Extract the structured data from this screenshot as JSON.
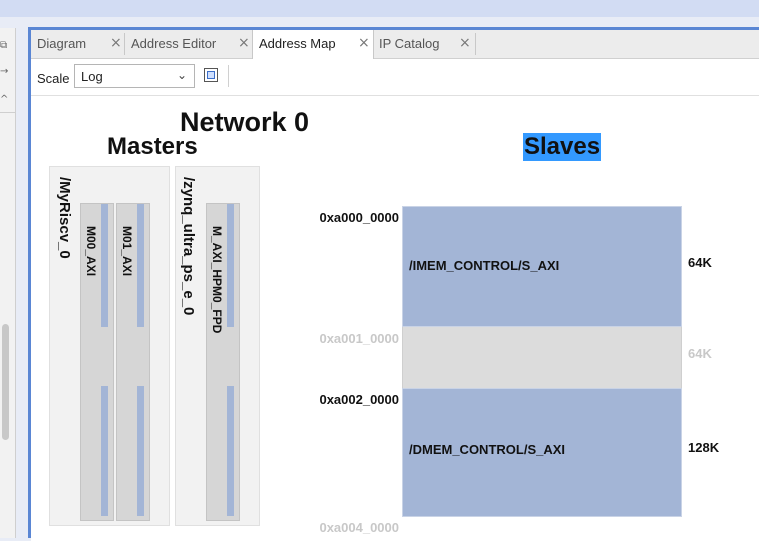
{
  "tabs": [
    {
      "label": "Diagram",
      "active": false
    },
    {
      "label": "Address Editor",
      "active": false
    },
    {
      "label": "Address Map",
      "active": true
    },
    {
      "label": "IP Catalog",
      "active": false
    }
  ],
  "toolbar": {
    "scale_label": "Scale",
    "scale_value": "Log"
  },
  "map": {
    "network_title": "Network 0",
    "masters_title": "Masters",
    "slaves_title": "Slaves",
    "masters": [
      {
        "name": "/MyRiscv_0",
        "interfaces": [
          "M00_AXI",
          "M01_AXI"
        ]
      },
      {
        "name": "/zynq_ultra_ps_e_0",
        "interfaces": [
          "M_AXI_HPM0_FPD"
        ]
      }
    ],
    "addresses": [
      "0xa000_0000",
      "0xa001_0000",
      "0xa002_0000",
      "0xa004_0000"
    ],
    "segments": [
      {
        "name": "/IMEM_CONTROL/S_AXI",
        "size": "64K",
        "mapped": true
      },
      {
        "name": "",
        "size": "64K",
        "mapped": false
      },
      {
        "name": "/DMEM_CONTROL/S_AXI",
        "size": "128K",
        "mapped": true
      }
    ]
  },
  "colors": {
    "segment_mapped": "#a3b5d6",
    "segment_unmapped": "#dcdcdc",
    "selection_highlight": "#3399ff",
    "active_border": "#5a86d4"
  }
}
